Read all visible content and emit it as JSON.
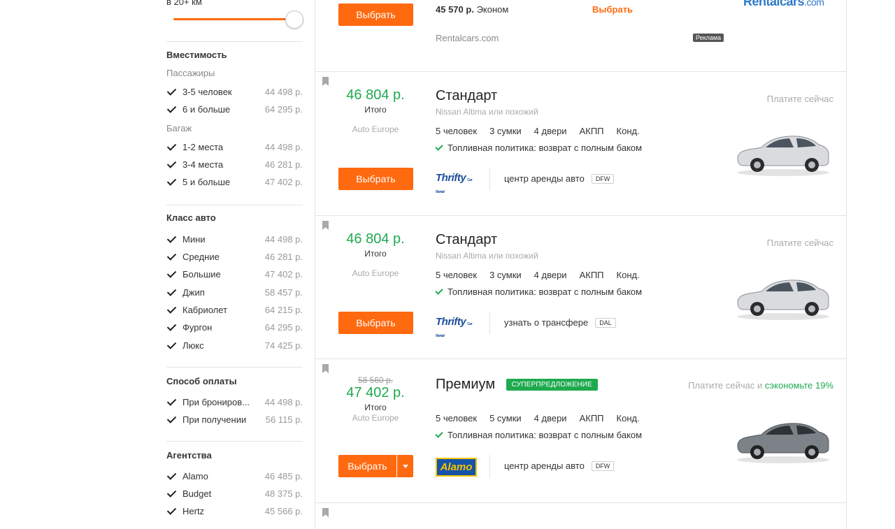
{
  "sidebar": {
    "distance_label": "в 20+ км",
    "capacity": {
      "title": "Вместимость",
      "passengers_title": "Пассажиры",
      "passengers": [
        {
          "label": "3-5 человек",
          "price": "44 498 р."
        },
        {
          "label": "6 и больше",
          "price": "64 295 р."
        }
      ],
      "luggage_title": "Багаж",
      "luggage": [
        {
          "label": "1-2 места",
          "price": "44 498 р."
        },
        {
          "label": "3-4 места",
          "price": "46 281 р."
        },
        {
          "label": "5 и больше",
          "price": "47 402 р."
        }
      ]
    },
    "car_class": {
      "title": "Класс авто",
      "items": [
        {
          "label": "Мини",
          "price": "44 498 р."
        },
        {
          "label": "Средние",
          "price": "46 281 р."
        },
        {
          "label": "Большие",
          "price": "47 402 р."
        },
        {
          "label": "Джип",
          "price": "58 457 р."
        },
        {
          "label": "Кабриолет",
          "price": "64 215 р."
        },
        {
          "label": "Фургон",
          "price": "64 295 р."
        },
        {
          "label": "Люкс",
          "price": "74 425 р."
        }
      ]
    },
    "payment": {
      "title": "Способ оплаты",
      "items": [
        {
          "label": "При брониров...",
          "price": "44 498 р."
        },
        {
          "label": "При получении",
          "price": "56 115 р."
        }
      ]
    },
    "agencies": {
      "title": "Агентства",
      "items": [
        {
          "label": "Alamo",
          "price": "46 485 р."
        },
        {
          "label": "Budget",
          "price": "48 375 р."
        },
        {
          "label": "Hertz",
          "price": "45 566 р."
        }
      ]
    }
  },
  "ad": {
    "button": "Выбрать",
    "price": "45 570 р.",
    "class": "Эконом",
    "select_link": "Выбрать",
    "site": "Rentalcars.com",
    "badge": "Реклама",
    "logo_main": "Rentalcars",
    "logo_com": ".com"
  },
  "results": [
    {
      "price": "46 804 р.",
      "price_sub": "Итого",
      "agency": "Auto Europe",
      "button": "Выбрать",
      "class": "Стандарт",
      "model": "Nissan Altima или похожий",
      "specs": [
        "5 человек",
        "3 сумки",
        "4 двери",
        "АКПП",
        "Конд."
      ],
      "fuel": "Топливная политика: возврат с полным баком",
      "pay": "Платите сейчас",
      "logo": "Thrifty",
      "logo_small": "Car Rental",
      "location": "центр аренды авто",
      "airport": "DFW",
      "car_color": "#d9dbde"
    },
    {
      "price": "46 804 р.",
      "price_sub": "Итого",
      "agency": "Auto Europe",
      "button": "Выбрать",
      "class": "Стандарт",
      "model": "Nissan Altima или похожий",
      "specs": [
        "5 человек",
        "3 сумки",
        "4 двери",
        "АКПП",
        "Конд."
      ],
      "fuel": "Топливная политика: возврат с полным баком",
      "pay": "Платите сейчас",
      "logo": "Thrifty",
      "logo_small": "Car Rental",
      "location": "узнать о трансфере",
      "airport": "DAL",
      "car_color": "#d9dbde"
    },
    {
      "old_price": "58 560 р.",
      "price": "47 402 р.",
      "price_sub": "Итого",
      "agency": "Auto Europe",
      "button": "Выбрать",
      "class": "Премиум",
      "badge": "СУПЕРПРЕДЛОЖЕНИЕ",
      "specs": [
        "5 человек",
        "5 сумки",
        "4 двери",
        "АКПП",
        "Конд."
      ],
      "fuel": "Топливная политика: возврат с полным баком",
      "pay": "Платите сейчас и",
      "pay_save": "сэкономьте 19%",
      "logo": "Alamo",
      "location": "центр аренды авто",
      "airport": "DFW",
      "car_color": "#7d8288"
    }
  ],
  "colors": {
    "accent": "#ff690f",
    "price_green": "#1faa4f"
  }
}
